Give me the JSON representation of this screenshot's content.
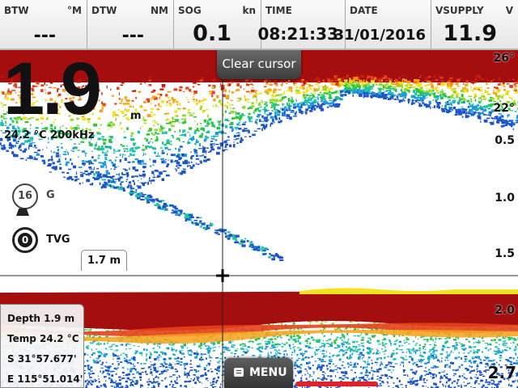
{
  "databar": {
    "btw": {
      "label": "BTW",
      "unit": "°M",
      "value": "---"
    },
    "dtw": {
      "label": "DTW",
      "unit": "NM",
      "value": "---"
    },
    "sog": {
      "label": "SOG",
      "unit": "kn",
      "value": "0.1"
    },
    "time": {
      "label": "TIME",
      "value": "08:21:33"
    },
    "date": {
      "label": "DATE",
      "value": "31/01/2016"
    },
    "vsupply": {
      "label": "VSUPPLY",
      "unit": "V",
      "value": "11.9"
    }
  },
  "sonar": {
    "depth_value": "1.9",
    "depth_unit": "m",
    "temp_freq": "24.2 °C   200kHz",
    "clear_cursor": "Clear cursor",
    "gain_value": "16",
    "gain_label": "G",
    "tvg_value": "0",
    "tvg_label": "TVG",
    "range": "1.7  m",
    "scale_top": [
      "26°",
      "22°",
      "0.5",
      "1.0",
      "1.5"
    ],
    "scale_bottom": [
      "2.0",
      "2.7"
    ],
    "cursor_info": {
      "depth": "Depth   1.9  m",
      "temp": "Temp  24.2 °C",
      "lat": "S    31°57.677'",
      "lon": "E  115°51.014'"
    },
    "menu": "MENU"
  },
  "colors": {
    "bottom_red": "#a50e0e",
    "cursor_line": "#222222",
    "scroll_indicator": "#e0232a"
  }
}
